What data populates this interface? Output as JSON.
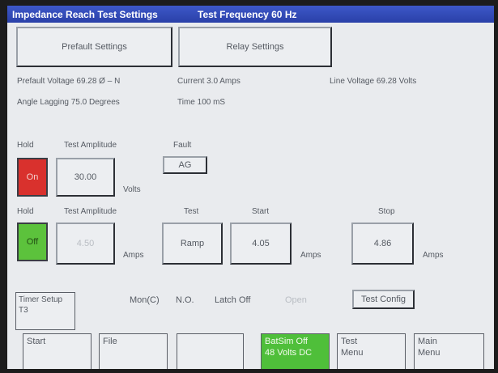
{
  "title": {
    "settings": "Impedance Reach Test Settings",
    "frequency": "Test Frequency 60 Hz"
  },
  "tabs": {
    "prefault": "Prefault Settings",
    "relay": "Relay Settings"
  },
  "info": {
    "prefault_voltage": "Prefault Voltage 69.28 Ø – N",
    "current": "Current 3.0 Amps",
    "line_voltage": "Line Voltage 69.28 Volts",
    "angle": "Angle Lagging 75.0 Degrees",
    "time": "Time 100 mS"
  },
  "row1": {
    "hold_label": "Hold",
    "amplitude_label": "Test Amplitude",
    "fault_label": "Fault",
    "hold_value": "On",
    "amplitude_value": "30.00",
    "unit": "Volts",
    "fault_value": "AG",
    "hold_color": "#d9312d"
  },
  "row2": {
    "hold_label": "Hold",
    "amplitude_label": "Test Amplitude",
    "test_label": "Test",
    "start_label": "Start",
    "stop_label": "Stop",
    "hold_value": "Off",
    "amplitude_value": "4.50",
    "amplitude_unit": "Amps",
    "test_value": "Ramp",
    "start_value": "4.05",
    "start_unit": "Amps",
    "stop_value": "4.86",
    "stop_unit": "Amps",
    "hold_color": "#5cc23c"
  },
  "timer": {
    "setup_line1": "Timer Setup",
    "setup_line2": "T3",
    "mon": "Mon(C)",
    "no": "N.O.",
    "latch": "Latch Off",
    "open": "Open",
    "config": "Test Config"
  },
  "bottom": {
    "start": "Start",
    "file": "File",
    "blank": "",
    "batsim_line1": "BatSim Off",
    "batsim_line2": "48 Volts DC",
    "batsim_color": "#4fbf3a",
    "test_menu_line1": "Test",
    "test_menu_line2": "Menu",
    "main_menu_line1": "Main",
    "main_menu_line2": "Menu"
  }
}
